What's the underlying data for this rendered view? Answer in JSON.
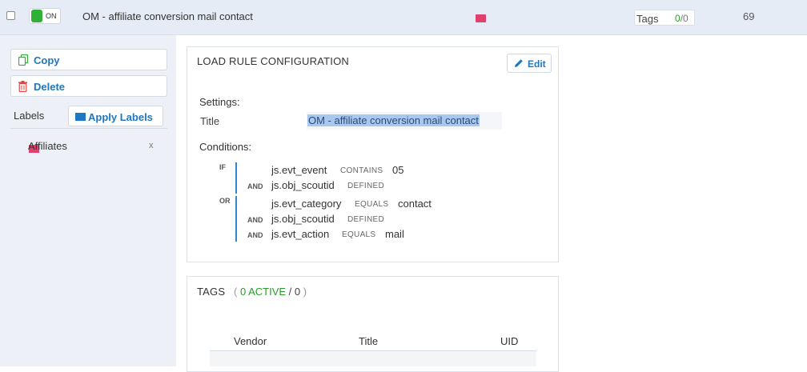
{
  "header": {
    "toggle_label": "ON",
    "title": "OM - affiliate conversion mail contact",
    "tags_label": "Tags",
    "tags_active": "0",
    "tags_total": "/0",
    "count": "69",
    "colors": {
      "toggle": "#2eb135",
      "label_folder": "#e0406e",
      "bg": "#e5ecf5"
    }
  },
  "sidebar": {
    "copy_label": "Copy",
    "delete_label": "Delete",
    "labels_heading": "Labels",
    "apply_labels": "Apply Labels",
    "labels": [
      {
        "name": "Affiliates",
        "remove": "x"
      }
    ]
  },
  "config": {
    "heading": "LOAD RULE CONFIGURATION",
    "edit_label": "Edit",
    "settings_heading": "Settings:",
    "title_label": "Title",
    "title_value": "OM - affiliate conversion mail contact",
    "conditions_heading": "Conditions:",
    "groups": [
      {
        "keyword": "IF",
        "rows": [
          {
            "join": "",
            "variable": "js.evt_event",
            "operator": "CONTAINS",
            "value": "05"
          },
          {
            "join": "AND",
            "variable": "js.obj_scoutid",
            "operator": "DEFINED",
            "value": ""
          }
        ]
      },
      {
        "keyword": "OR",
        "rows": [
          {
            "join": "",
            "variable": "js.evt_category",
            "operator": "EQUALS",
            "value": "contact"
          },
          {
            "join": "AND",
            "variable": "js.obj_scoutid",
            "operator": "DEFINED",
            "value": ""
          },
          {
            "join": "AND",
            "variable": "js.evt_action",
            "operator": "EQUALS",
            "value": "mail"
          }
        ]
      }
    ]
  },
  "tags_panel": {
    "heading": "TAGS",
    "open_paren": "(",
    "active": "0 ACTIVE",
    "slash_total": "/ 0",
    "close_paren": ")",
    "columns": [
      "Vendor",
      "Title",
      "UID"
    ]
  }
}
